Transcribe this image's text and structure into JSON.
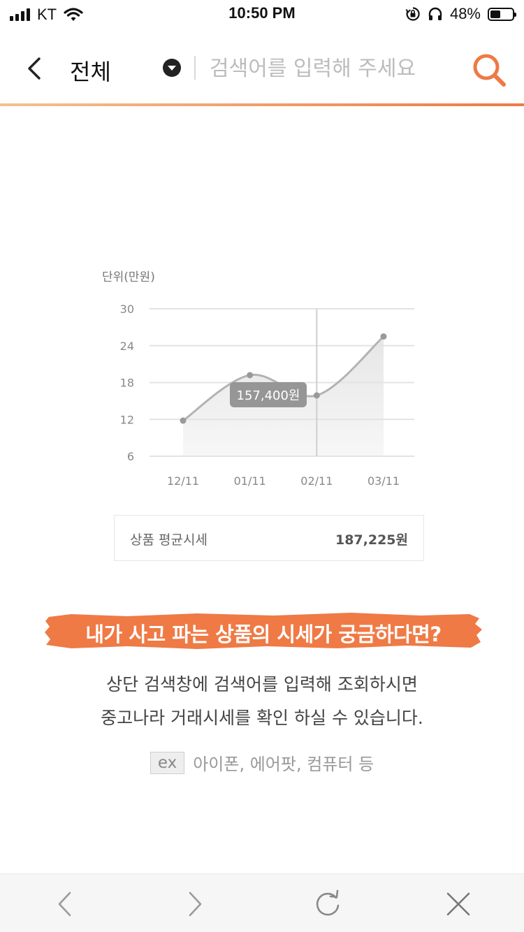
{
  "status_bar": {
    "carrier": "KT",
    "time": "10:50 PM",
    "battery_percent": "48%",
    "battery_level": 0.48,
    "icons": [
      "signal-icon",
      "wifi-icon",
      "orientation-lock-icon",
      "headphones-icon",
      "battery-icon"
    ]
  },
  "header": {
    "back_icon": "chevron-left-icon",
    "category": "전체",
    "dropdown_icon": "dropdown-circle-icon",
    "search_placeholder": "검색어를 입력해 주세요",
    "search_value": "",
    "search_icon": "search-icon",
    "accent_color": "#ee7a45"
  },
  "chart_data": {
    "type": "line",
    "unit_label": "단위(만원)",
    "categories": [
      "12/11",
      "01/11",
      "02/11",
      "03/11"
    ],
    "values": [
      11.8,
      19.2,
      15.9,
      25.5
    ],
    "yticks": [
      30,
      24,
      18,
      12,
      6
    ],
    "ylim": [
      6,
      30
    ],
    "grid": true,
    "selected_index": 2,
    "tooltip": "157,400원",
    "line_color": "#b3b3b3",
    "fill_color": "#e6e6e6"
  },
  "average": {
    "label": "상품 평균시세",
    "value": "187,225원"
  },
  "promo": {
    "headline": "내가 사고 파는 상품의 시세가 궁금하다면?",
    "line1": "상단 검색창에 검색어를 입력해 조회하시면",
    "line2": "중고나라 거래시세를 확인 하실 수 있습니다.",
    "example_badge": "ex",
    "examples": "아이폰, 에어팟, 컴퓨터 등",
    "banner_color": "#ef7a45"
  },
  "bottom_bar": {
    "icons": [
      "back-arrow-icon",
      "forward-arrow-icon",
      "refresh-icon",
      "close-icon"
    ]
  }
}
